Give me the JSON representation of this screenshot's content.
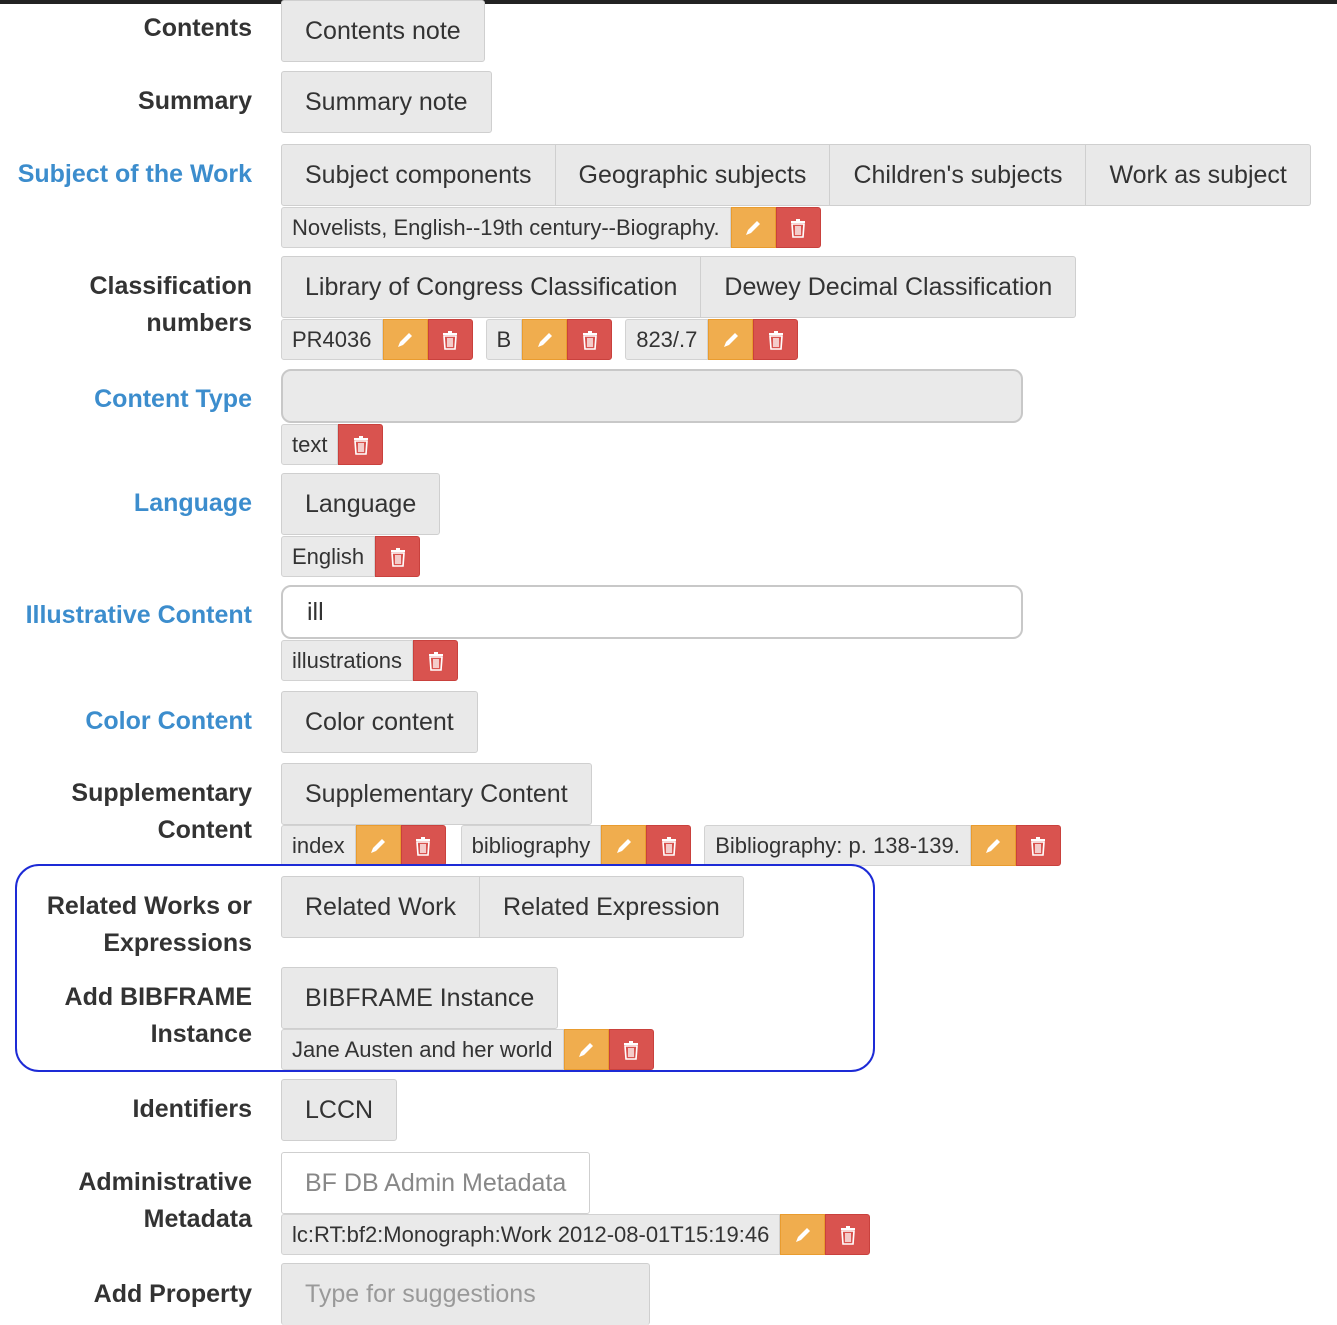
{
  "labels": {
    "contents": "Contents",
    "summary": "Summary",
    "subject": "Subject of the Work",
    "classification_1": "Classification",
    "classification_2": "numbers",
    "content_type": "Content Type",
    "language": "Language",
    "illustrative": "Illustrative Content",
    "color": "Color Content",
    "supplementary_1": "Supplementary",
    "supplementary_2": "Content",
    "related_1": "Related Works or",
    "related_2": "Expressions",
    "add_bibframe_1": "Add BIBFRAME",
    "add_bibframe_2": "Instance",
    "identifiers": "Identifiers",
    "admin_1": "Administrative",
    "admin_2": "Metadata",
    "add_property": "Add Property"
  },
  "buttons": {
    "contents_note": "Contents note",
    "summary_note": "Summary note",
    "subject_components": "Subject components",
    "geographic_subjects": "Geographic subjects",
    "childrens_subjects": "Children's subjects",
    "work_as_subject": "Work as subject",
    "lcc": "Library of Congress Classification",
    "ddc": "Dewey Decimal Classification",
    "language": "Language",
    "color_content": "Color content",
    "supplementary_content": "Supplementary Content",
    "related_work": "Related Work",
    "related_expression": "Related Expression",
    "bibframe_instance": "BIBFRAME Instance",
    "lccn": "LCCN",
    "bf_db_admin": "BF DB Admin Metadata",
    "type_for_suggestions": "Type for suggestions"
  },
  "inputs": {
    "content_type_value": "",
    "illustrative_value": "ill"
  },
  "chips": {
    "subject": "Novelists, English--19th century--Biography.",
    "class_1": "PR4036",
    "class_2": "B",
    "class_3": "823/.7",
    "content_type": "text",
    "language": "English",
    "illustrative": "illustrations",
    "supp_1": "index",
    "supp_2": "bibliography",
    "supp_3": "Bibliography: p. 138-139.",
    "instance": "Jane Austen and her world",
    "admin": "lc:RT:bf2:Monograph:Work 2012-08-01T15:19:46"
  },
  "colors": {
    "label_blue": "#3c8dcd",
    "edit_orange": "#f0ad4e",
    "delete_red": "#d9534f",
    "highlight_frame": "#1d2bd6"
  },
  "icons": {
    "edit": "pencil-icon",
    "delete": "trash-icon"
  }
}
